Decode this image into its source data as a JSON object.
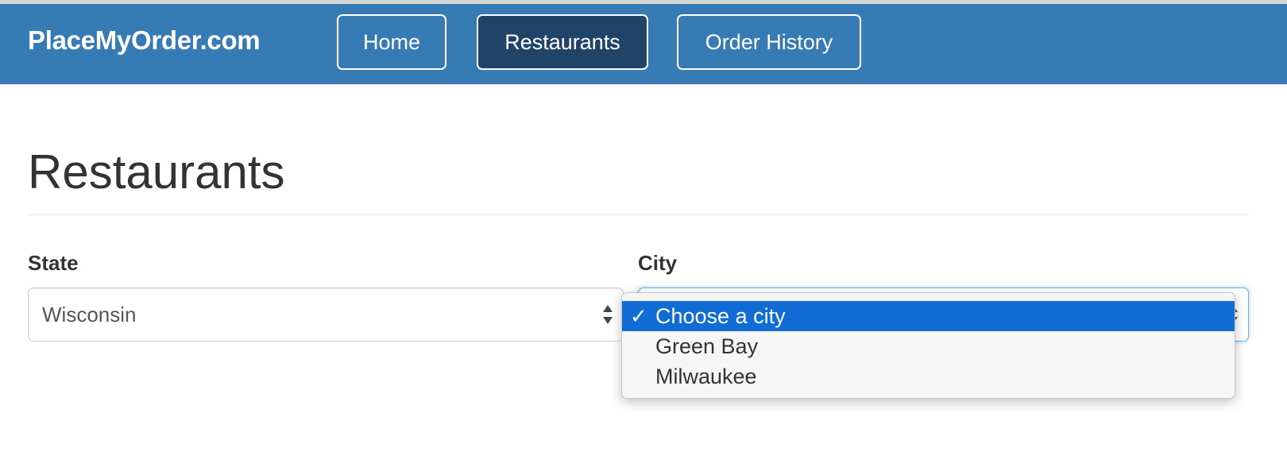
{
  "header": {
    "brand": "PlaceMyOrder.com",
    "nav": [
      {
        "label": "Home",
        "active": false
      },
      {
        "label": "Restaurants",
        "active": true
      },
      {
        "label": "Order History",
        "active": false
      }
    ]
  },
  "main": {
    "title": "Restaurants",
    "state": {
      "label": "State",
      "value": "Wisconsin"
    },
    "city": {
      "label": "City",
      "dropdown_open": true,
      "options": [
        {
          "label": "Choose a city",
          "selected": true
        },
        {
          "label": "Green Bay",
          "selected": false
        },
        {
          "label": "Milwaukee",
          "selected": false
        }
      ]
    }
  },
  "icons": {
    "selected_check": "✓",
    "select_arrows": "updown-arrows-icon"
  },
  "colors": {
    "navbar": "#377bb5",
    "active_nav": "#1f4468",
    "selected_option": "#116cd6",
    "focus_border": "#66afe9"
  }
}
